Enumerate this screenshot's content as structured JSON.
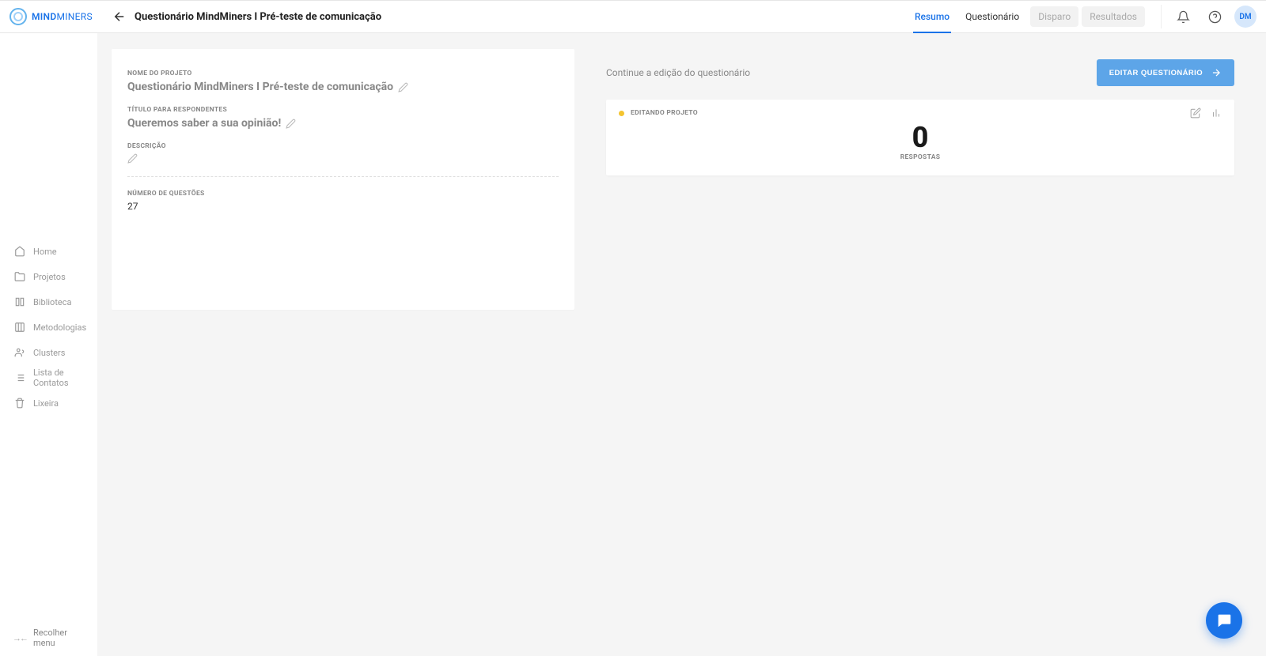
{
  "brand": {
    "name_bold": "MIND",
    "name_thin": "MINERS"
  },
  "header": {
    "title": "Questionário MindMiners I Pré-teste de comunicação",
    "tabs": [
      {
        "label": "Resumo",
        "active": true,
        "disabled": false
      },
      {
        "label": "Questionário",
        "active": false,
        "disabled": false
      },
      {
        "label": "Disparo",
        "active": false,
        "disabled": true
      },
      {
        "label": "Resultados",
        "active": false,
        "disabled": true
      }
    ],
    "avatar": "DM"
  },
  "sidebar": {
    "items": [
      {
        "label": "Home"
      },
      {
        "label": "Projetos"
      },
      {
        "label": "Biblioteca"
      },
      {
        "label": "Metodologias"
      },
      {
        "label": "Clusters"
      },
      {
        "label": "Lista de Contatos"
      },
      {
        "label": "Lixeira"
      }
    ],
    "collapse": "Recolher menu"
  },
  "project": {
    "name_label": "NOME DO PROJETO",
    "name_value": "Questionário MindMiners I Pré-teste de comunicação",
    "title_label": "TÍTULO PARA RESPONDENTES",
    "title_value": "Queremos saber a sua opinião!",
    "desc_label": "DESCRIÇÃO",
    "desc_value": "",
    "qcount_label": "NÚMERO DE QUESTÕES",
    "qcount_value": "27"
  },
  "right": {
    "prompt": "Continue a edição do questionário",
    "button": "EDITAR QUESTIONÁRIO",
    "status": "EDITANDO PROJETO",
    "responses_value": "0",
    "responses_label": "RESPOSTAS"
  }
}
